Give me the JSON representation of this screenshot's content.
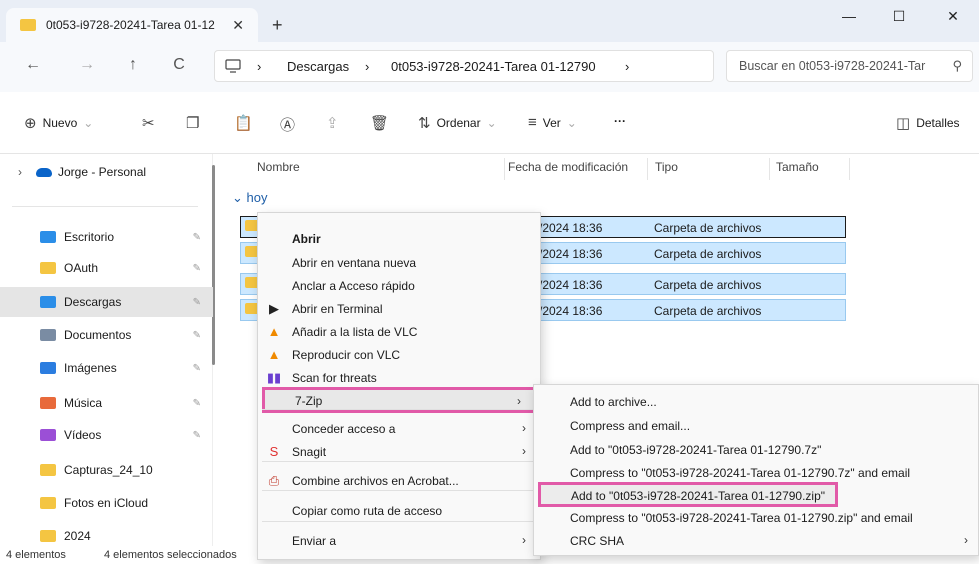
{
  "window": {
    "tab_title": "0t053-i9728-20241-Tarea 01-12",
    "new_tab": "+",
    "minimize": "—",
    "maximize": "☐",
    "close": "✕"
  },
  "nav": {
    "back": "←",
    "forward": "→",
    "up": "↑",
    "refresh": "C"
  },
  "breadcrumb": {
    "sep": "›",
    "items": [
      "Descargas",
      "0t053-i9728-20241-Tarea 01-12790"
    ]
  },
  "search": {
    "placeholder": "Buscar en 0t053-i9728-20241-Tar"
  },
  "toolbar": {
    "new_label": "Nuevo",
    "sort_label": "Ordenar",
    "view_label": "Ver",
    "more": "···",
    "details_label": "Detalles"
  },
  "sidebar": {
    "account": "Jorge - Personal",
    "items": [
      {
        "label": "Escritorio",
        "color": "#2b8ee8",
        "pinned": true
      },
      {
        "label": "OAuth",
        "color": "#f4c542",
        "pinned": true
      },
      {
        "label": "Descargas",
        "color": "#2b8ee8",
        "pinned": true,
        "selected": true
      },
      {
        "label": "Documentos",
        "color": "#7a8ca3",
        "pinned": true
      },
      {
        "label": "Imágenes",
        "color": "#2b7de0",
        "pinned": true
      },
      {
        "label": "Música",
        "color": "#e86a3b",
        "pinned": true
      },
      {
        "label": "Vídeos",
        "color": "#9b4fd6",
        "pinned": true
      },
      {
        "label": "Capturas_24_10",
        "color": "#f4c542",
        "pinned": false
      },
      {
        "label": "Fotos en iCloud",
        "color": "#f4c542",
        "pinned": false
      },
      {
        "label": "2024",
        "color": "#f4c542",
        "pinned": false
      }
    ]
  },
  "columns": {
    "name": "Nombre",
    "date": "Fecha de modificación",
    "type": "Tipo",
    "size": "Tamaño"
  },
  "group": {
    "label": "hoy"
  },
  "rows": [
    {
      "date": "/2024 18:36",
      "type": "Carpeta de archivos"
    },
    {
      "date": "/2024 18:36",
      "type": "Carpeta de archivos"
    },
    {
      "date": "/2024 18:36",
      "type": "Carpeta de archivos"
    },
    {
      "date": "/2024 18:36",
      "type": "Carpeta de archivos"
    }
  ],
  "status": {
    "count": "4 elementos",
    "selected": "4 elementos seleccionados"
  },
  "context_menu": {
    "items": [
      {
        "label": "Abrir"
      },
      {
        "label": "Abrir en ventana nueva"
      },
      {
        "label": "Anclar a Acceso rápido"
      },
      {
        "label": "Abrir en Terminal"
      },
      {
        "label": "Añadir a la lista de VLC"
      },
      {
        "label": "Reproducir con VLC"
      },
      {
        "label": "Scan for threats"
      },
      {
        "label": "7-Zip"
      },
      {
        "label": "Conceder acceso a"
      },
      {
        "label": "Snagit"
      },
      {
        "label": "Combine archivos en Acrobat..."
      },
      {
        "label": "Copiar como ruta de acceso"
      },
      {
        "label": "Enviar a"
      }
    ],
    "submenu_arrow": "›"
  },
  "submenu": {
    "items": [
      {
        "label": "Add to archive..."
      },
      {
        "label": "Compress and email..."
      },
      {
        "label": "Add to \"0t053-i9728-20241-Tarea 01-12790.7z\""
      },
      {
        "label": "Compress to \"0t053-i9728-20241-Tarea 01-12790.7z\" and email"
      },
      {
        "label": "Add to \"0t053-i9728-20241-Tarea 01-12790.zip\""
      },
      {
        "label": "Compress to \"0t053-i9728-20241-Tarea 01-12790.zip\" and email"
      },
      {
        "label": "CRC SHA"
      }
    ]
  }
}
